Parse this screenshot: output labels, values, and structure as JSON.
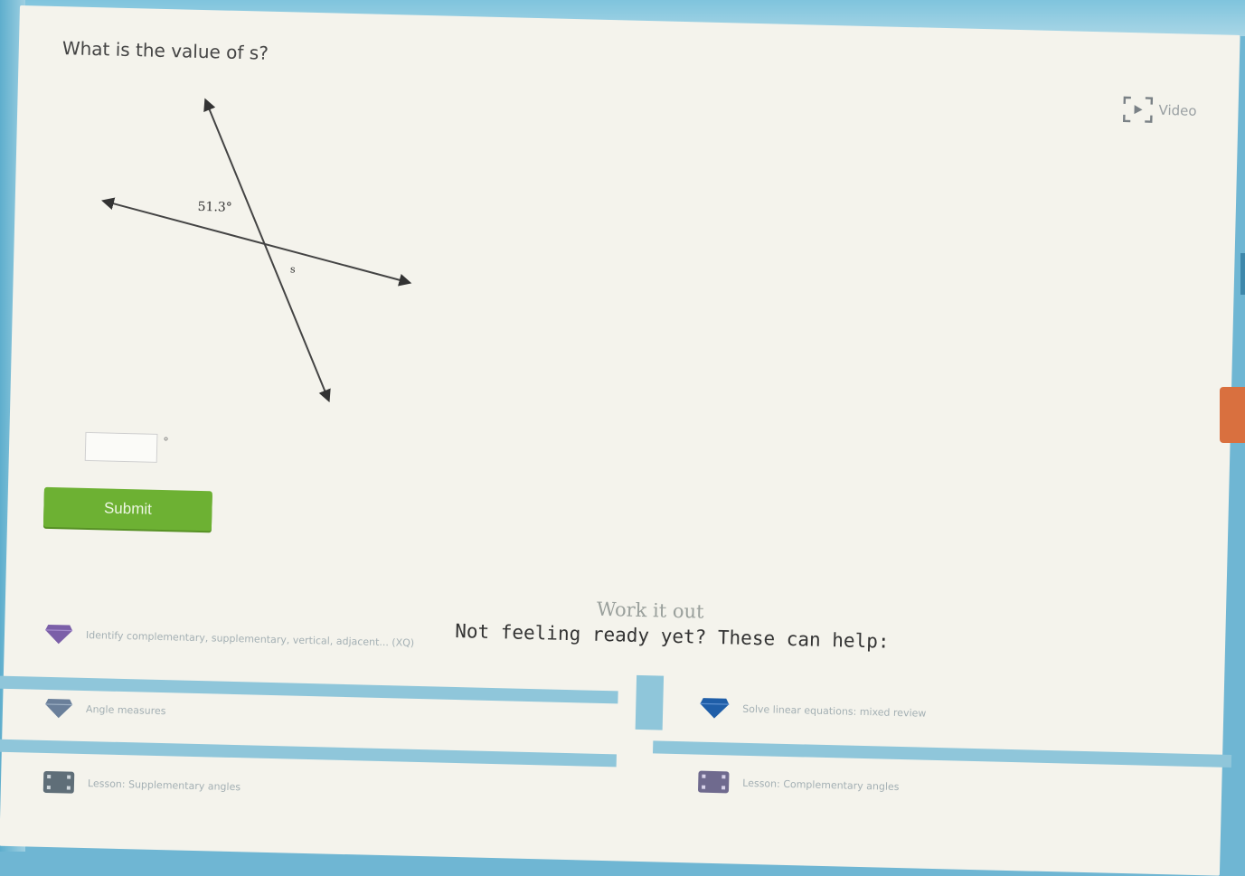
{
  "question": {
    "text": "What is the value of s?"
  },
  "video": {
    "label": "Video"
  },
  "diagram": {
    "angle_label": "51.3°",
    "variable_label": "s"
  },
  "answer": {
    "value": "",
    "unit": "°"
  },
  "submit": {
    "label": "Submit"
  },
  "help": {
    "title": "Work it out",
    "prompt": "Not feeling ready yet? These can help:",
    "items": [
      {
        "label": "Identify complementary, supplementary, vertical, adjacent...  (XQ)",
        "icon": "gem-icon"
      },
      {
        "label": "Solve linear equations: mixed review",
        "icon": "gem-icon"
      },
      {
        "label": "Angle measures",
        "icon": "gem-icon"
      },
      {
        "label": "Lesson: Complementary angles",
        "icon": "film-icon"
      },
      {
        "label": "Lesson: Supplementary angles",
        "icon": "film-icon"
      }
    ]
  },
  "colors": {
    "submit_green": "#6db133",
    "background": "#f4f3ec",
    "accent_blue": "#6fb6d3",
    "gem_purple": "#7b5fa8"
  }
}
